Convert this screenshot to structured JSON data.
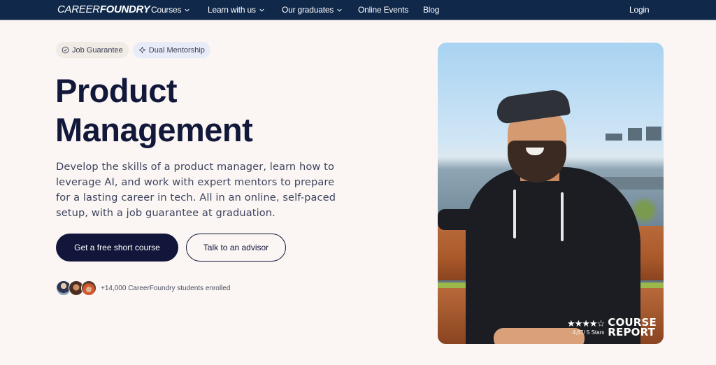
{
  "nav": {
    "logo_light": "CAREER",
    "logo_bold": "FOUNDRY",
    "items": [
      {
        "label": "Courses",
        "has_dropdown": true
      },
      {
        "label": "Learn with us",
        "has_dropdown": true
      },
      {
        "label": "Our graduates",
        "has_dropdown": true
      },
      {
        "label": "Online Events",
        "has_dropdown": false
      },
      {
        "label": "Blog",
        "has_dropdown": false
      }
    ],
    "login_label": "Login"
  },
  "hero": {
    "badges": [
      {
        "icon": "check-circle-icon",
        "label": "Job Guarantee"
      },
      {
        "icon": "sparkle-diamond-icon",
        "label": "Dual Mentorship"
      }
    ],
    "title_line1": "Product",
    "title_line2": "Management",
    "description": "Develop the skills of a product manager, learn how to leverage AI, and work with expert mentors to prepare for a lasting career in tech. All in an online, self-paced setup, with a job guarantee at graduation.",
    "primary_button": "Get a free short course",
    "secondary_button": "Talk to an advisor",
    "enrolled_text": "+14,000 CareerFoundry students enrolled"
  },
  "rating": {
    "stars_display": "★★★★☆",
    "stars_value": 4.67,
    "stars_max": 5,
    "score_text": "4,67/ 5 Stars",
    "brand_line1": "COURSE",
    "brand_line2": "REPORT"
  },
  "colors": {
    "nav_bg": "#10284a",
    "page_bg": "#fbf6f3",
    "primary": "#11163a"
  }
}
